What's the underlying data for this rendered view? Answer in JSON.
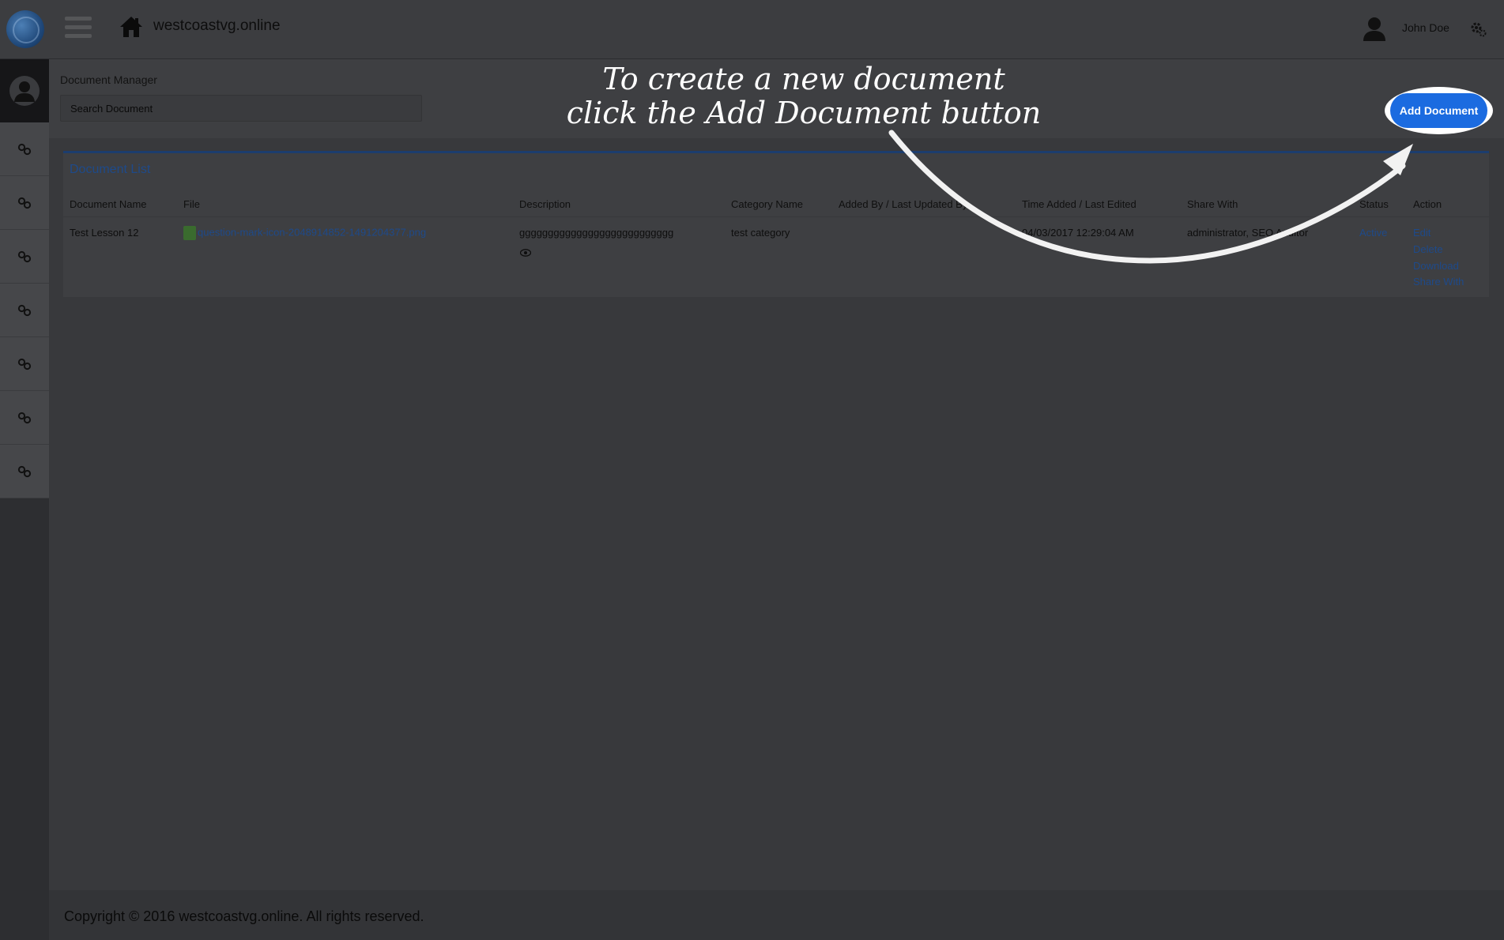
{
  "header": {
    "site_name": "westcoastvg.online",
    "user_name": "John Doe"
  },
  "page": {
    "label": "Document Manager",
    "search_placeholder": "Search Document",
    "add_button": "Add Document"
  },
  "callout": {
    "line1": "To create a new document",
    "line2": "click the Add Document button"
  },
  "sidebar": {
    "items": [
      "link-icon",
      "link-icon",
      "link-icon",
      "link-icon",
      "link-icon",
      "link-icon",
      "link-icon"
    ]
  },
  "panel": {
    "title": "Document List",
    "columns": [
      "Document Name",
      "File",
      "Description",
      "Category Name",
      "Added By / Last Updated By",
      "Time Added / Last Edited",
      "Share With",
      "Status",
      "Action"
    ],
    "rows": [
      {
        "name": "Test Lesson 12",
        "file": "question-mark-icon-2048914852-1491204377.png",
        "description": "ggggggggggggggggggggggggggg",
        "category": "test category",
        "added_by": "",
        "time": "04/03/2017 12:29:04 AM",
        "share_with": "administrator, SEO Auditor",
        "status": "Active",
        "actions": [
          "Edit",
          "Delete",
          "Download",
          "Share With"
        ]
      }
    ]
  },
  "footer": {
    "text": "Copyright © 2016 westcoastvg.online. All rights reserved."
  },
  "colors": {
    "accent": "#1b6be0",
    "link": "#1e4a8a",
    "overlay_bg": "#38393c"
  }
}
